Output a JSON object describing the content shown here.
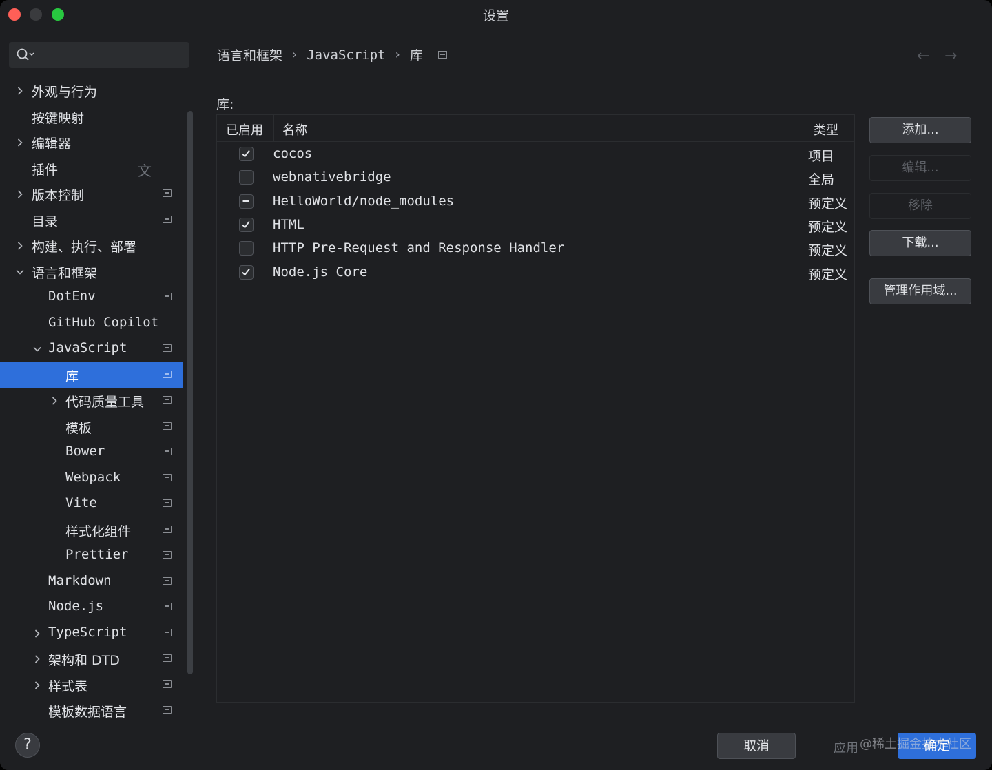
{
  "window": {
    "title": "设置",
    "traffic_lights": {
      "close": "#ff5f57",
      "minimize": "#3a3b3e",
      "zoom": "#28c840"
    }
  },
  "sidebar": {
    "search": {
      "placeholder": "",
      "icon": "search-icon"
    },
    "tree": [
      {
        "label": "外观与行为",
        "depth": 0,
        "expander": "collapsed",
        "badge": ""
      },
      {
        "label": "按键映射",
        "depth": 0,
        "expander": "none",
        "badge": ""
      },
      {
        "label": "编辑器",
        "depth": 0,
        "expander": "collapsed",
        "badge": ""
      },
      {
        "label": "插件",
        "depth": 0,
        "expander": "none",
        "badge": "translate-icon"
      },
      {
        "label": "版本控制",
        "depth": 0,
        "expander": "collapsed",
        "badge": "project-icon"
      },
      {
        "label": "目录",
        "depth": 0,
        "expander": "none",
        "badge": "project-icon"
      },
      {
        "label": "构建、执行、部署",
        "depth": 0,
        "expander": "collapsed",
        "badge": ""
      },
      {
        "label": "语言和框架",
        "depth": 0,
        "expander": "expanded",
        "badge": ""
      },
      {
        "label": "DotEnv",
        "depth": 1,
        "expander": "none",
        "badge": "project-icon",
        "mono": true
      },
      {
        "label": "GitHub Copilot",
        "depth": 1,
        "expander": "none",
        "badge": "",
        "mono": true
      },
      {
        "label": "JavaScript",
        "depth": 1,
        "expander": "expanded",
        "badge": "project-icon",
        "mono": true
      },
      {
        "label": "库",
        "depth": 2,
        "expander": "none",
        "badge": "project-icon",
        "selected": true
      },
      {
        "label": "代码质量工具",
        "depth": 2,
        "expander": "collapsed",
        "badge": "project-icon"
      },
      {
        "label": "模板",
        "depth": 2,
        "expander": "none",
        "badge": "project-icon"
      },
      {
        "label": "Bower",
        "depth": 2,
        "expander": "none",
        "badge": "project-icon",
        "mono": true
      },
      {
        "label": "Webpack",
        "depth": 2,
        "expander": "none",
        "badge": "project-icon",
        "mono": true
      },
      {
        "label": "Vite",
        "depth": 2,
        "expander": "none",
        "badge": "project-icon",
        "mono": true
      },
      {
        "label": "样式化组件",
        "depth": 2,
        "expander": "none",
        "badge": "project-icon"
      },
      {
        "label": "Prettier",
        "depth": 2,
        "expander": "none",
        "badge": "project-icon",
        "mono": true
      },
      {
        "label": "Markdown",
        "depth": 1,
        "expander": "none",
        "badge": "project-icon",
        "mono": true
      },
      {
        "label": "Node.js",
        "depth": 1,
        "expander": "none",
        "badge": "project-icon",
        "mono": true
      },
      {
        "label": "TypeScript",
        "depth": 1,
        "expander": "collapsed",
        "badge": "project-icon",
        "mono": true
      },
      {
        "label": "架构和 DTD",
        "depth": 1,
        "expander": "collapsed",
        "badge": "project-icon"
      },
      {
        "label": "样式表",
        "depth": 1,
        "expander": "collapsed",
        "badge": "project-icon"
      },
      {
        "label": "模板数据语言",
        "depth": 1,
        "expander": "none",
        "badge": "project-icon"
      }
    ]
  },
  "main": {
    "breadcrumb": [
      "语言和框架",
      "JavaScript",
      "库"
    ],
    "breadcrumb_separator": "›",
    "nav": {
      "back": "←",
      "forward": "→"
    },
    "libraries_label": "库:",
    "table": {
      "headers": {
        "enabled": "已启用",
        "name": "名称",
        "type": "类型"
      },
      "rows": [
        {
          "state": "checked",
          "name": "cocos",
          "type": "项目"
        },
        {
          "state": "unchecked",
          "name": "webnativebridge",
          "type": "全局"
        },
        {
          "state": "partial",
          "name": "HelloWorld/node_modules",
          "type": "预定义"
        },
        {
          "state": "checked",
          "name": "HTML",
          "type": "预定义"
        },
        {
          "state": "unchecked",
          "name": "HTTP Pre-Request and Response Handler",
          "type": "预定义"
        },
        {
          "state": "checked",
          "name": "Node.js Core",
          "type": "预定义"
        }
      ]
    },
    "buttons": {
      "add": "添加...",
      "edit": "编辑...",
      "remove": "移除",
      "download": "下载...",
      "manage_scopes": "管理作用域..."
    }
  },
  "footer": {
    "help": "?",
    "cancel": "取消",
    "apply": "应用",
    "ok": "确定",
    "watermark": "@稀土掘金技术社区"
  },
  "colors": {
    "accent": "#2e6fdb",
    "background": "#1e1f22",
    "panel": "#2b2d30"
  }
}
